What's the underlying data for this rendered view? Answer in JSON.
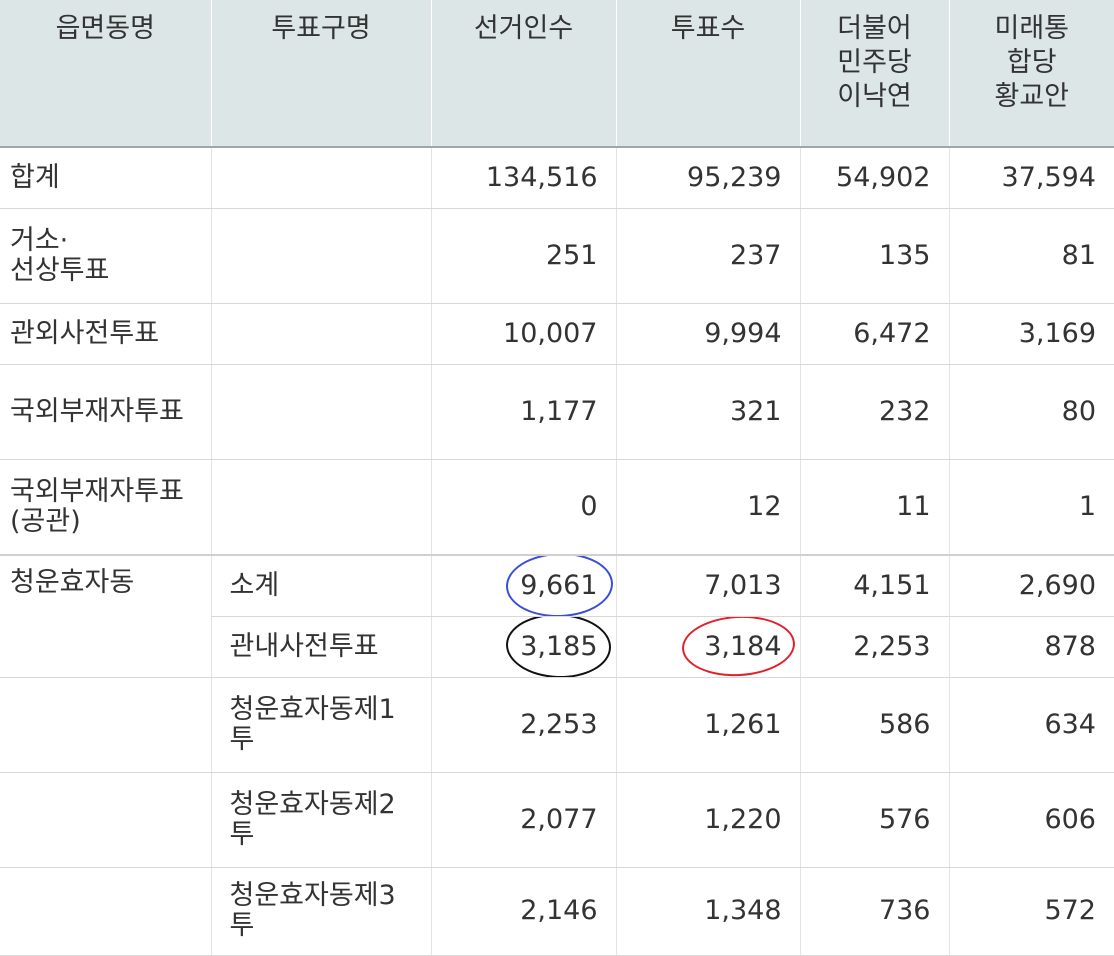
{
  "headers": [
    "읍면동명",
    "투표구명",
    "선거인수",
    "투표수",
    "더불어\n민주당\n이낙연",
    "미래통\n합당\n황교안"
  ],
  "rows": [
    {
      "dong": "합계",
      "gu": "",
      "electors": "134,516",
      "votes": "95,239",
      "lee": "54,902",
      "hwang": "37,594"
    },
    {
      "dong": "거소·\n선상투표",
      "gu": "",
      "electors": "251",
      "votes": "237",
      "lee": "135",
      "hwang": "81"
    },
    {
      "dong": "관외사전투표",
      "gu": "",
      "electors": "10,007",
      "votes": "9,994",
      "lee": "6,472",
      "hwang": "3,169"
    },
    {
      "dong": "국외부재자투표",
      "gu": "",
      "electors": "1,177",
      "votes": "321",
      "lee": "232",
      "hwang": "80"
    },
    {
      "dong": "국외부재자투표(공관)",
      "gu": "",
      "electors": "0",
      "votes": "12",
      "lee": "11",
      "hwang": "1"
    },
    {
      "dong": "청운효자동",
      "gu": "소계",
      "electors": "9,661",
      "votes": "7,013",
      "lee": "4,151",
      "hwang": "2,690"
    },
    {
      "dong": "",
      "gu": "관내사전투표",
      "electors": "3,185",
      "votes": "3,184",
      "lee": "2,253",
      "hwang": "878"
    },
    {
      "dong": "",
      "gu": "청운효자동제1투",
      "electors": "2,253",
      "votes": "1,261",
      "lee": "586",
      "hwang": "634"
    },
    {
      "dong": "",
      "gu": "청운효자동제2투",
      "electors": "2,077",
      "votes": "1,220",
      "lee": "576",
      "hwang": "606"
    },
    {
      "dong": "",
      "gu": "청운효자동제3투",
      "electors": "2,146",
      "votes": "1,348",
      "lee": "736",
      "hwang": "572"
    }
  ],
  "annotations": {
    "blue": "#3b4fd1",
    "black": "#111111",
    "red": "#e0202a"
  }
}
